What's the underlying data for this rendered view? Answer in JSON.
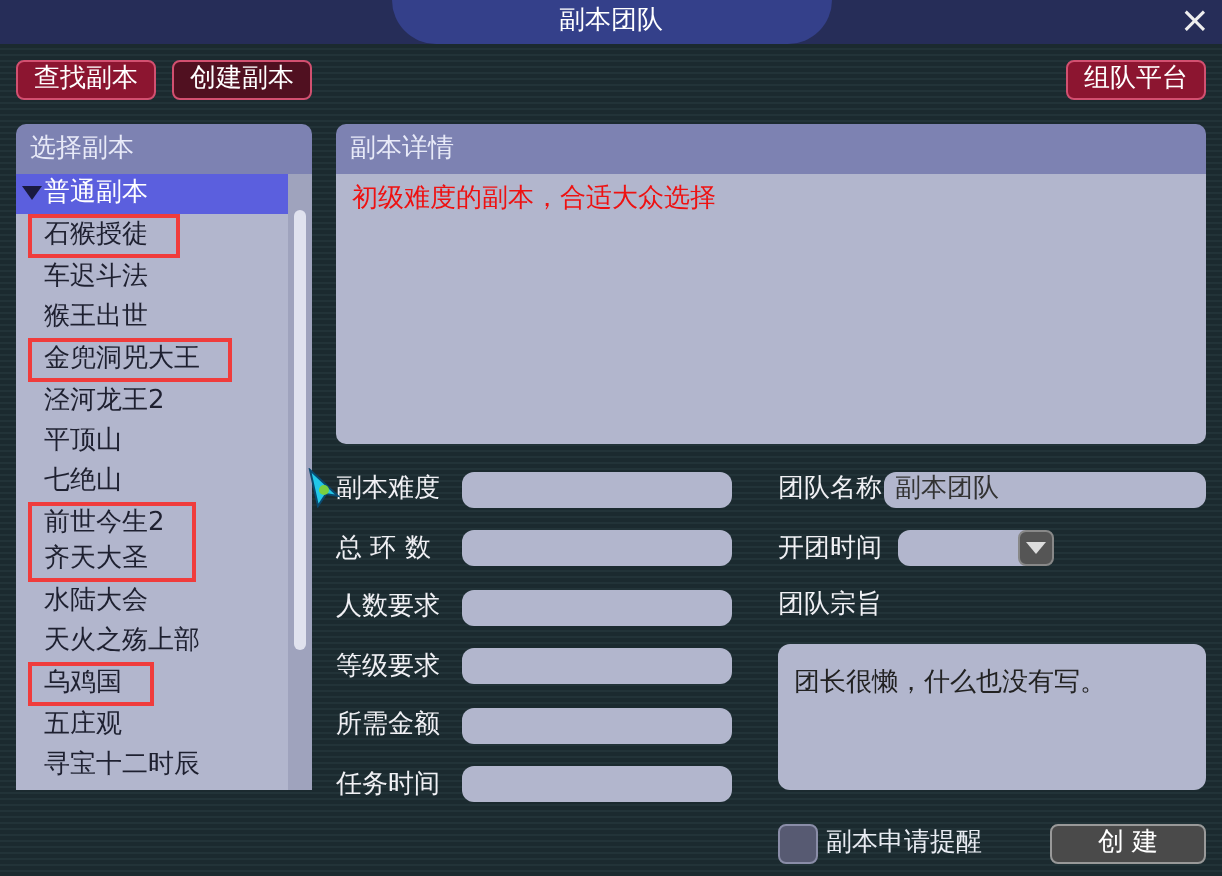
{
  "window": {
    "title": "副本团队",
    "close": "×"
  },
  "toolbar": [
    {
      "label": "查找副本",
      "selected": false
    },
    {
      "label": "创建副本",
      "selected": true
    }
  ],
  "platform_button": "组队平台",
  "dungeon_list": {
    "title": "选择副本",
    "category": {
      "label": "普通副本",
      "expanded": true,
      "selected": true
    },
    "items": [
      {
        "label": "石猴授徒",
        "highlighted": true
      },
      {
        "label": "车迟斗法",
        "highlighted": false
      },
      {
        "label": "猴王出世",
        "highlighted": false
      },
      {
        "label": "金兜洞兕大王",
        "highlighted": true
      },
      {
        "label": "泾河龙王2",
        "highlighted": false
      },
      {
        "label": "平顶山",
        "highlighted": false
      },
      {
        "label": "七绝山",
        "highlighted": false
      },
      {
        "label": "前世今生2",
        "highlighted": true
      },
      {
        "label": "齐天大圣",
        "highlighted": true
      },
      {
        "label": "水陆大会",
        "highlighted": false
      },
      {
        "label": "天火之殇上部",
        "highlighted": false
      },
      {
        "label": "乌鸡国",
        "highlighted": true
      },
      {
        "label": "五庄观",
        "highlighted": false
      },
      {
        "label": "寻宝十二时辰",
        "highlighted": false
      }
    ]
  },
  "details": {
    "title": "副本详情",
    "text": "初级难度的副本，合适大众选择"
  },
  "fields_left": [
    {
      "label": "副本难度"
    },
    {
      "label": "总 环 数"
    },
    {
      "label": "人数要求"
    },
    {
      "label": "等级要求"
    },
    {
      "label": "所需金额"
    },
    {
      "label": "任务时间"
    }
  ],
  "team_name": {
    "label": "团队名称",
    "value": "副本团队"
  },
  "start_time": {
    "label": "开团时间"
  },
  "purpose": {
    "label": "团队宗旨",
    "value": "团长很懒，什么也没有写。"
  },
  "notify": {
    "label": "副本申请提醒",
    "checked": false
  },
  "create_button": "创 建"
}
